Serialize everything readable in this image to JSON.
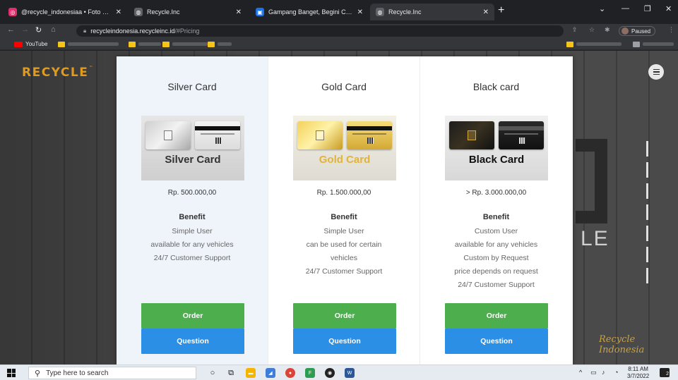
{
  "tabs": [
    {
      "title": "@recycle_indonesiaa • Foto dan",
      "icon": "instagram-icon",
      "color": "#e1306c"
    },
    {
      "title": "Recycle.Inc",
      "icon": "globe-icon",
      "color": "#5f6368"
    },
    {
      "title": "Gampang Banget, Begini Cara M",
      "icon": "site-favicon-icon",
      "color": "#1a73e8"
    },
    {
      "title": "Recycle.Inc",
      "icon": "globe-icon",
      "color": "#5f6368"
    }
  ],
  "address": {
    "host": "recycleindonesia.recycleinc.id",
    "path": "/#Pricing"
  },
  "profile": {
    "label": "Paused"
  },
  "bookmarks": {
    "youtube": "YouTube"
  },
  "page": {
    "logo": "RECYCLE",
    "logo_mark": "™",
    "big_text": "LE",
    "signature": "Recycle Indonesia"
  },
  "cards": [
    {
      "title": "Silver Card",
      "image_label": "Silver Card",
      "price": "Rp. 500.000,00",
      "benefit_heading": "Benefit",
      "benefits": [
        "Simple User",
        "available for any vehicles",
        "24/7 Customer Support"
      ],
      "order": "Order",
      "question": "Question"
    },
    {
      "title": "Gold Card",
      "image_label": "Gold Card",
      "price": "Rp. 1.500.000,00",
      "benefit_heading": "Benefit",
      "benefits": [
        "Simple User",
        "can be used for certain",
        "vehicles",
        "24/7 Customer Support"
      ],
      "order": "Order",
      "question": "Question"
    },
    {
      "title": "Black card",
      "image_label": "Black Card",
      "price": "> Rp. 3.000.000,00",
      "benefit_heading": "Benefit",
      "benefits": [
        "Custom User",
        "available for any vehicles",
        "Custom by Request",
        "price depends on request",
        "24/7 Customer Support"
      ],
      "order": "Order",
      "question": "Question"
    }
  ],
  "taskbar": {
    "search_placeholder": "Type here to search",
    "time": "8:11 AM",
    "date": "3/7/2022",
    "notifications": "2"
  },
  "colors": {
    "logo": "#e09a1e",
    "order": "#4cae4c",
    "question": "#2b8fe6"
  }
}
